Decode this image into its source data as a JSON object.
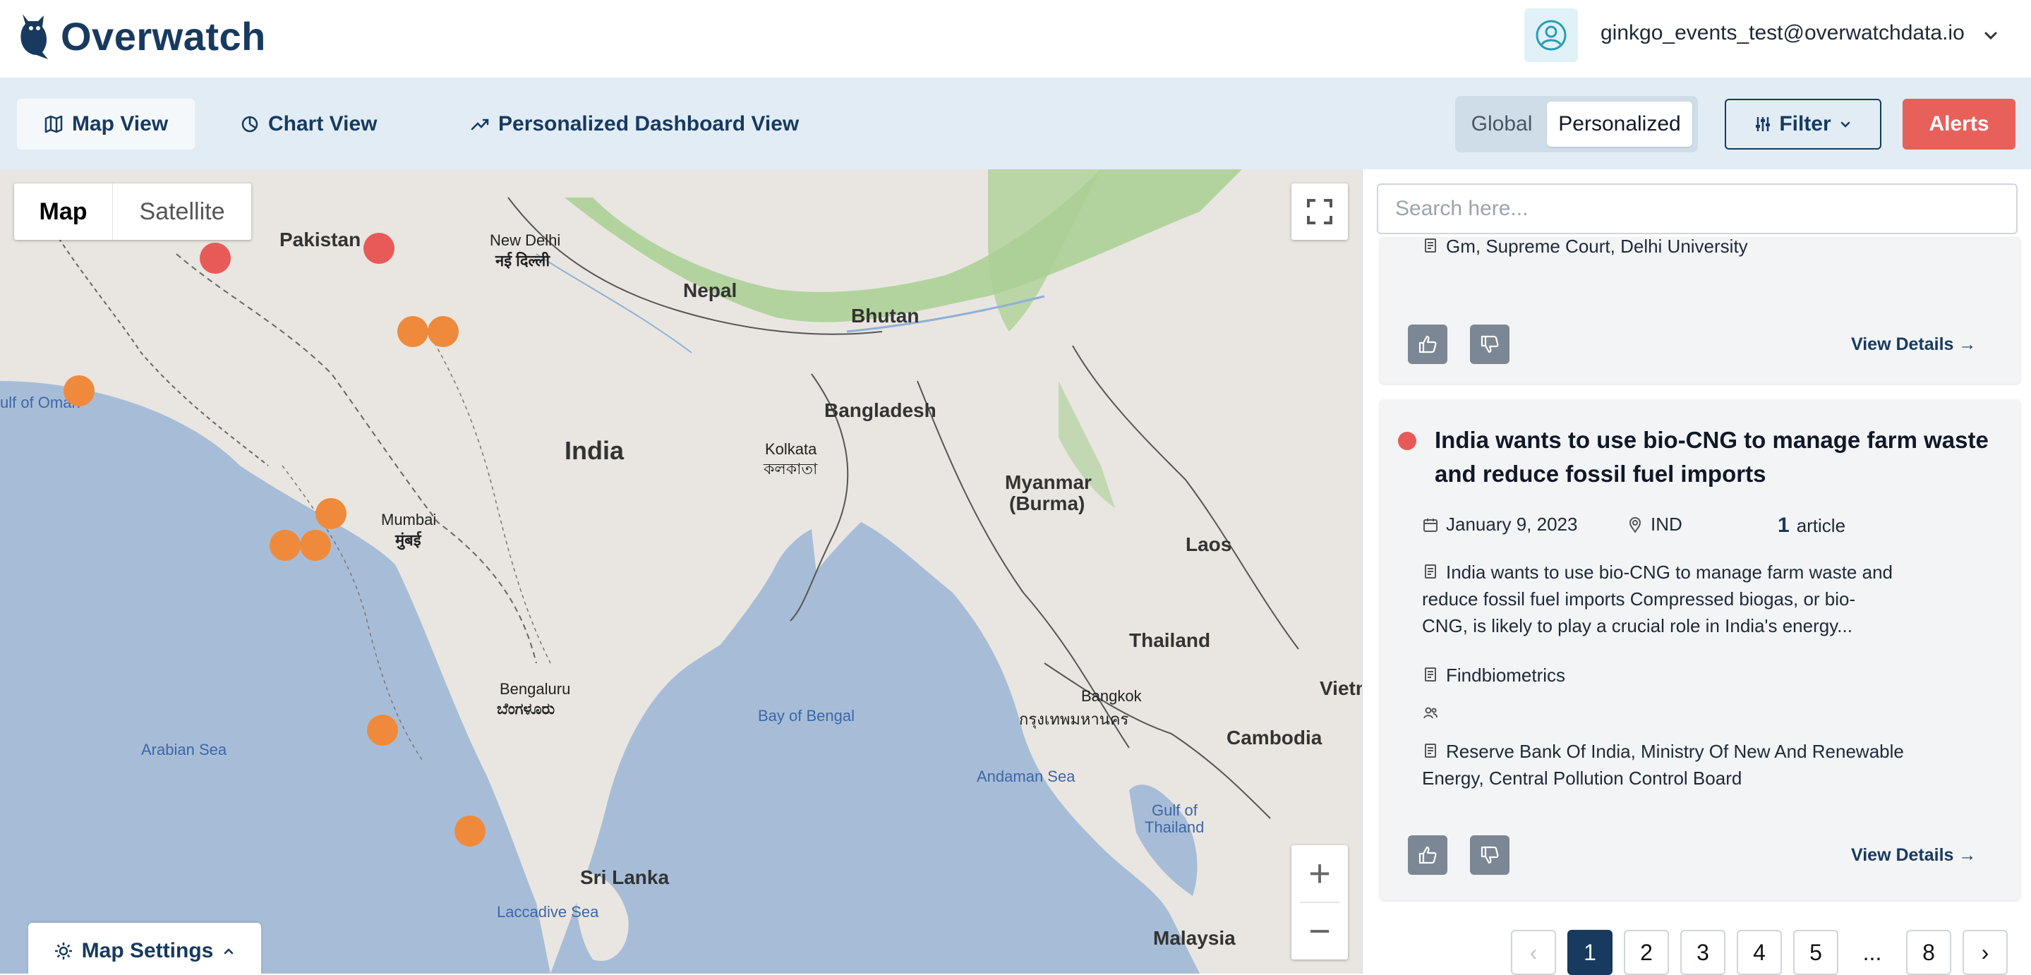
{
  "app": {
    "name": "Overwatch"
  },
  "user": {
    "email": "ginkgo_events_test@overwatchdata.io"
  },
  "nav": {
    "tabs": [
      {
        "label": "Map View",
        "icon": "map-icon",
        "active": true
      },
      {
        "label": "Chart View",
        "icon": "chart-pie-icon",
        "active": false
      },
      {
        "label": "Personalized Dashboard View",
        "icon": "trend-up-icon",
        "active": false
      }
    ],
    "scope_toggle": {
      "options": [
        "Global",
        "Personalized"
      ],
      "selected": "Personalized"
    },
    "filter_label": "Filter",
    "alerts_label": "Alerts"
  },
  "map": {
    "type_options": [
      "Map",
      "Satellite"
    ],
    "selected_type": "Map",
    "settings_label": "Map Settings",
    "zoom_in": "+",
    "zoom_out": "−",
    "labels": {
      "pakistan": "Pakistan",
      "new_delhi": "New Delhi",
      "new_delhi_native": "नई दिल्ली",
      "nepal": "Nepal",
      "bhutan": "Bhutan",
      "gulf_of_oman": "ulf of Oman",
      "bangladesh": "Bangladesh",
      "india": "India",
      "kolkata": "Kolkata",
      "kolkata_native": "কলকাতা",
      "myanmar": "Myanmar",
      "myanmar_2": "(Burma)",
      "mumbai": "Mumbai",
      "mumbai_native": "मुंबई",
      "laos": "Laos",
      "thailand": "Thailand",
      "bengaluru": "Bengaluru",
      "bengaluru_native": "ಬೆಂಗಳೂರು",
      "bay_of_bengal": "Bay of Bengal",
      "bangkok": "Bangkok",
      "bangkok_native": "กรุงเทพมหานคร",
      "vietnam": "Vietn",
      "arabian_sea": "Arabian Sea",
      "cambodia": "Cambodia",
      "andaman_sea": "Andaman Sea",
      "gulf_of_thailand_1": "Gulf of",
      "gulf_of_thailand_2": "Thailand",
      "sri_lanka": "Sri Lanka",
      "laccadive_sea": "Laccadive Sea",
      "malaysia": "Malaysia"
    },
    "markers": [
      {
        "color": "red",
        "lat": 30.6,
        "lng": 76.9
      },
      {
        "color": "red",
        "lat": 30.2,
        "lng": 71.5
      },
      {
        "color": "orange",
        "lat": 27.2,
        "lng": 78.0
      },
      {
        "color": "orange",
        "lat": 27.2,
        "lng": 79.0
      },
      {
        "color": "orange",
        "lat": 24.8,
        "lng": 67.0
      },
      {
        "color": "orange",
        "lat": 19.8,
        "lng": 75.3
      },
      {
        "color": "orange",
        "lat": 18.5,
        "lng": 73.8
      },
      {
        "color": "orange",
        "lat": 18.5,
        "lng": 74.8
      },
      {
        "color": "orange",
        "lat": 11.0,
        "lng": 77.0
      },
      {
        "color": "orange",
        "lat": 6.9,
        "lng": 79.9
      }
    ]
  },
  "panel": {
    "search_placeholder": "Search here...",
    "cards": [
      {
        "entities": "Gm, Supreme Court, Delhi University",
        "view_details": "View Details →"
      },
      {
        "status": "red",
        "title": "India wants to use bio-CNG to manage farm waste and reduce fossil fuel imports",
        "date": "January 9, 2023",
        "location": "IND",
        "article_count": "1",
        "article_word": "article",
        "summary_line1": "India wants to use bio-CNG to manage farm waste and",
        "summary_line2": "reduce fossil fuel imports Compressed biogas, or bio-",
        "summary_line3": "CNG, is likely to play a crucial role in India's energy...",
        "source": "Findbiometrics",
        "people": "",
        "organizations_line1": "Reserve Bank Of India, Ministry Of New And Renewable",
        "organizations_line2": "Energy, Central Pollution Control Board",
        "view_details": "View Details →"
      }
    ],
    "pagination": {
      "prev": "‹",
      "pages": [
        "1",
        "2",
        "3",
        "4",
        "5"
      ],
      "ellipsis": "...",
      "last": "8",
      "next": "›",
      "current": "1"
    }
  },
  "colors": {
    "brand": "#173a5e",
    "alert": "#e8605a",
    "marker_orange": "#ef8a3c",
    "marker_red": "#e75a58",
    "water": "#a7bdd7",
    "land": "#e9e6e1",
    "forest": "#a9cf92"
  }
}
